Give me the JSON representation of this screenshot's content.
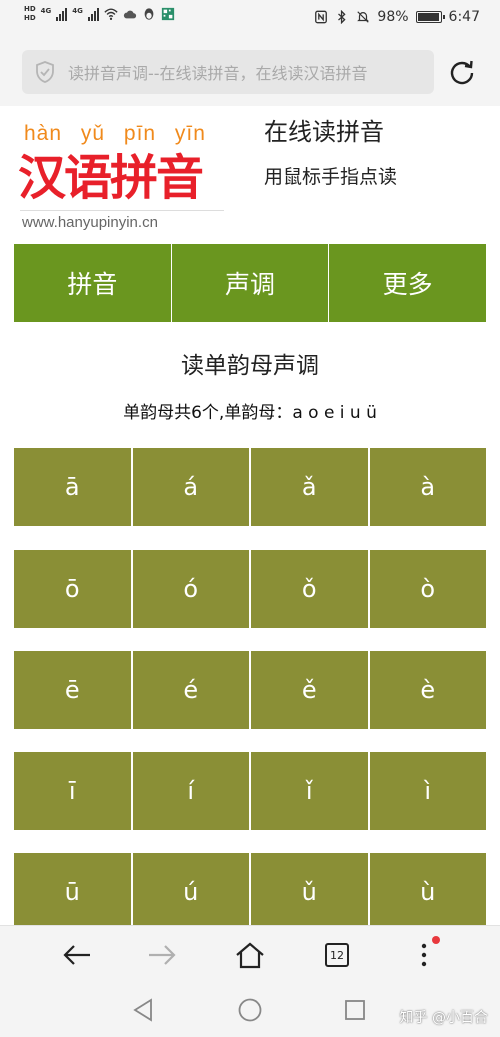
{
  "status_bar": {
    "hd_labels": [
      "HD",
      "HD"
    ],
    "network_labels": [
      "4G",
      "4G"
    ],
    "battery_percent": "98%",
    "battery_level": 0.98,
    "time": "6:47",
    "icons": [
      "signal-icon",
      "wifi-icon",
      "cloud-icon",
      "penguin-icon",
      "qr-app-icon",
      "nfc-icon",
      "bluetooth-icon",
      "mute-icon",
      "battery-icon"
    ]
  },
  "address_bar": {
    "text": "读拼音声调--在线读拼音，在线读汉语拼音",
    "icons": [
      "shield-icon",
      "reload-icon"
    ]
  },
  "header": {
    "logo_pinyin": "hàn yǔ pīn yīn",
    "logo_hanzi": "汉语拼音",
    "logo_url": "www.hanyupinyin.cn",
    "site_title": "在线读拼音",
    "site_subtitle": "用鼠标手指点读"
  },
  "nav": {
    "items": [
      {
        "label": "拼音"
      },
      {
        "label": "声调"
      },
      {
        "label": "更多"
      }
    ]
  },
  "section": {
    "title": "读单韵母声调",
    "description": "单韵母共6个,单韵母：a o e i u ü"
  },
  "tones": {
    "rows": [
      [
        "ā",
        "á",
        "ǎ",
        "à"
      ],
      [
        "ō",
        "ó",
        "ǒ",
        "ò"
      ],
      [
        "ē",
        "é",
        "ě",
        "è"
      ],
      [
        "ī",
        "í",
        "ǐ",
        "ì"
      ],
      [
        "ū",
        "ú",
        "ǔ",
        "ù"
      ]
    ]
  },
  "toolbar": {
    "tab_count": "12",
    "icons": [
      "back-arrow-icon",
      "forward-arrow-icon",
      "home-icon",
      "tabs-icon",
      "more-vertical-icon"
    ]
  },
  "system_nav": {
    "icons": [
      "back-triangle-icon",
      "home-circle-icon",
      "recents-square-icon"
    ],
    "watermark": "知乎 @小百合"
  },
  "colors": {
    "nav_green": "#6a961f",
    "tone_olive": "#8a8f36",
    "logo_red": "#e8202a",
    "logo_orange": "#f08a1c"
  }
}
